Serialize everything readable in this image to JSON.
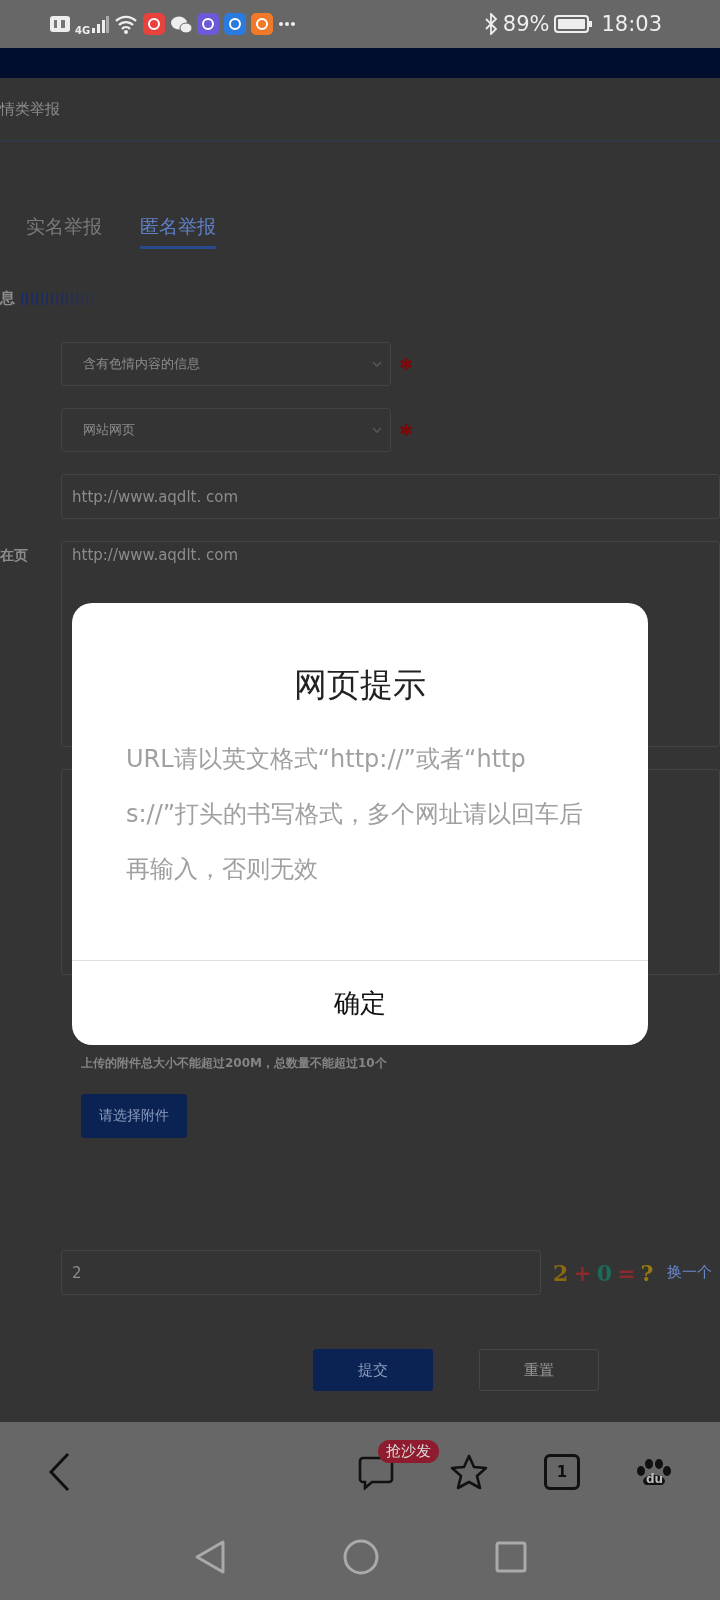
{
  "status_bar": {
    "network": "4G",
    "battery": "89%",
    "time": "18:03"
  },
  "page": {
    "title": "情类举报",
    "tabs": [
      {
        "label": "实名举报",
        "selected": false
      },
      {
        "label": "匿名举报",
        "selected": true
      }
    ],
    "section_heading": "息",
    "fields": [
      {
        "kind": "select",
        "value": "含有色情内容的信息",
        "required": true
      },
      {
        "kind": "select",
        "value": "网站网页",
        "required": true
      },
      {
        "kind": "input",
        "value": "http://www.aqdlt. com"
      },
      {
        "kind": "textarea",
        "label": "在页",
        "value": "http://www.aqdlt. com"
      },
      {
        "kind": "textarea"
      }
    ],
    "attachment_note": "上传的附件总大小不能超过200M，总数量不能超过10个",
    "attachment_button": "请选择附件",
    "captcha": {
      "value": "2",
      "chars": [
        {
          "text": "2",
          "color": "#8a6a10"
        },
        {
          "text": "+",
          "color": "#8a2a2a"
        },
        {
          "text": "0",
          "color": "#1e6a5a"
        },
        {
          "text": "=",
          "color": "#8a2a2a"
        },
        {
          "text": "?",
          "color": "#9a7a10"
        }
      ],
      "refresh": "换一个"
    },
    "buttons": [
      {
        "kind": "primary",
        "label": "提交"
      },
      {
        "kind": "secondary",
        "label": "重置"
      }
    ]
  },
  "dialog": {
    "title": "网页提示",
    "message": "URL请以英文格式“http://”或者“https://”打头的书写格式，多个网址请以回车后再输入，否则无效",
    "button": "确定"
  },
  "browser_toolbar": {
    "comment_badge": "抢沙发",
    "tab_count": "1",
    "logo_text": "du"
  }
}
